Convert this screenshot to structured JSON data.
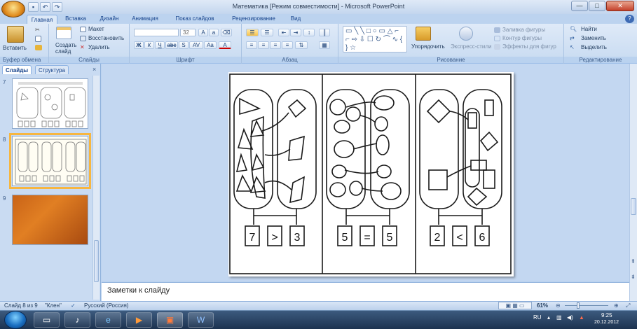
{
  "window": {
    "title": "Математика [Режим совместимости] - Microsoft PowerPoint",
    "controls": [
      "—",
      "□",
      "✕"
    ]
  },
  "tabs": [
    "Главная",
    "Вставка",
    "Дизайн",
    "Анимация",
    "Показ слайдов",
    "Рецензирование",
    "Вид"
  ],
  "ribbon": {
    "clipboard": {
      "paste": "Вставить",
      "label": "Буфер обмена"
    },
    "slides": {
      "new_slide": "Создать слайд",
      "layout": "Макет",
      "reset": "Восстановить",
      "delete": "Удалить",
      "label": "Слайды"
    },
    "font": {
      "size": "32",
      "label": "Шрифт",
      "buttons": [
        "Ж",
        "К",
        "Ч",
        "abc",
        "S",
        "AV",
        "Aa",
        "A"
      ]
    },
    "paragraph": {
      "label": "Абзац"
    },
    "drawing": {
      "arrange": "Упорядочить",
      "quick_styles": "Экспресс-стили",
      "fill": "Заливка фигуры",
      "outline": "Контур фигуры",
      "effects": "Эффекты для фигур",
      "label": "Рисование"
    },
    "editing": {
      "find": "Найти",
      "replace": "Заменить",
      "select": "Выделить",
      "label": "Редактирование"
    }
  },
  "left_pane": {
    "tabs": [
      "Слайды",
      "Структура"
    ],
    "close": "×",
    "thumbnails": [
      {
        "number": "7",
        "selected": false
      },
      {
        "number": "8",
        "selected": true
      },
      {
        "number": "9",
        "selected": false
      }
    ]
  },
  "slide": {
    "panels": [
      {
        "left": "7",
        "sign": ">",
        "right": "3"
      },
      {
        "left": "5",
        "sign": "=",
        "right": "5"
      },
      {
        "left": "2",
        "sign": "<",
        "right": "6"
      }
    ]
  },
  "notes": {
    "placeholder": "Заметки к слайду"
  },
  "status": {
    "slide_info": "Слайд 8 из 9",
    "theme": "\"Клен\"",
    "language": "Русский (Россия)",
    "zoom": "61%"
  },
  "taskbar": {
    "lang": "RU",
    "time": "9:25",
    "date": "20.12.2012"
  }
}
